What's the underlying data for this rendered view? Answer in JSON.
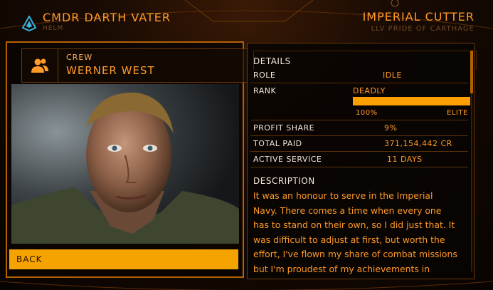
{
  "header": {
    "commander": "CMDR DARTH VATER",
    "role": "HELM",
    "ship_type": "IMPERIAL CUTTER",
    "ship_name": "LLV PRIDE OF CARTHAGE"
  },
  "crew": {
    "label": "CREW",
    "name": "WERNER WEST",
    "back_label": "BACK"
  },
  "details": {
    "title": "DETAILS",
    "role_label": "ROLE",
    "role_value": "IDLE",
    "rank_label": "RANK",
    "rank_value": "DEADLY",
    "rank_progress_percent": 100,
    "rank_progress_text": "100%",
    "rank_next": "ELITE",
    "profit_label": "PROFIT SHARE",
    "profit_value": "9%",
    "paid_label": "TOTAL PAID",
    "paid_value": "371,154,442 CR",
    "service_label": "ACTIVE SERVICE",
    "service_value": "11 DAYS"
  },
  "description": {
    "title": "DESCRIPTION",
    "lines": [
      "It was an honour to serve in the Imperial",
      "Navy. There comes a time when every one",
      "has to stand on their own, so I did just that. It",
      "was difficult to adjust at first, but worth the",
      "effort, I've flown my share of combat missions",
      "but I'm proudest of my achievements in"
    ]
  },
  "colors": {
    "accent": "#ff9a28",
    "button": "#f5a300",
    "label": "#f0e6dc"
  }
}
